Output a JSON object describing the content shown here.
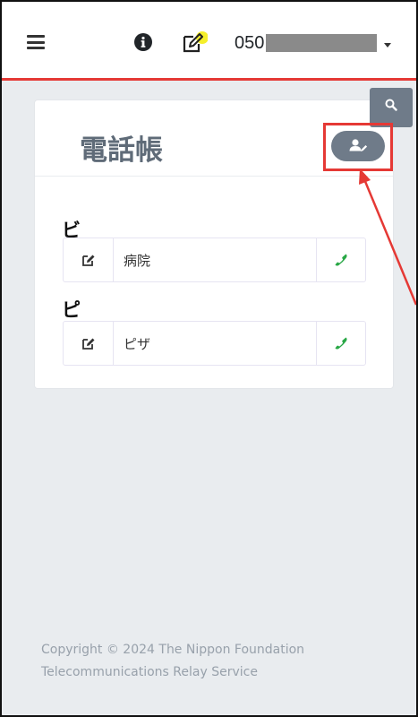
{
  "header": {
    "phone_prefix": "050",
    "menu_icon": "hamburger-menu-icon",
    "info_icon": "info-circle-icon",
    "edit_icon": "edit-note-icon"
  },
  "search": {
    "icon": "search-icon"
  },
  "phonebook": {
    "title": "電話帳",
    "add_contact_icon": "add-contact-icon",
    "groups": [
      {
        "letter": "ビ",
        "contacts": [
          {
            "name": "病院"
          }
        ]
      },
      {
        "letter": "ピ",
        "contacts": [
          {
            "name": "ピザ"
          }
        ]
      }
    ]
  },
  "footer": {
    "line1": "Copyright © 2024 The Nippon Foundation",
    "line2": "Telecommunications Relay Service"
  },
  "colors": {
    "accent_red": "#e53935",
    "button_gray": "#6f7b89",
    "call_green": "#28a745",
    "title_gray": "#5f6b78",
    "highlight_yellow": "#f5ef2b"
  }
}
